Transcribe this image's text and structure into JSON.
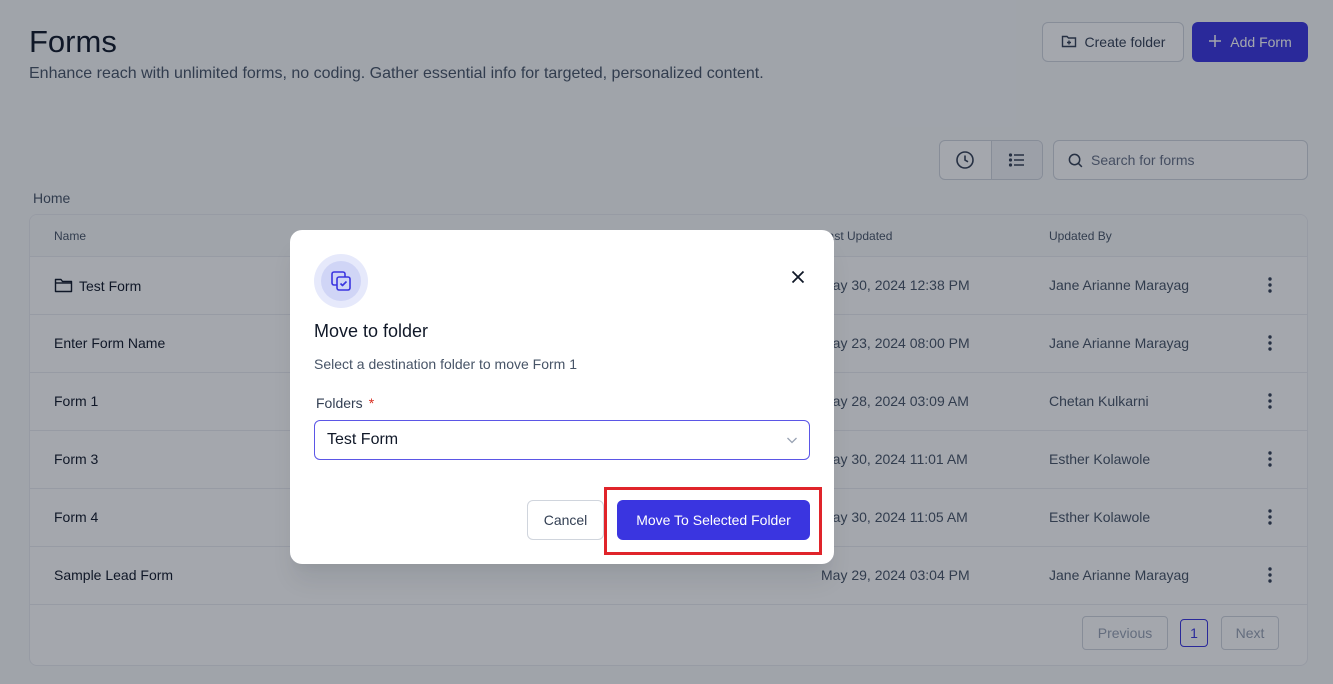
{
  "header": {
    "title": "Forms",
    "subtitle": "Enhance reach with unlimited forms, no coding. Gather essential info for targeted, personalized content.",
    "create_folder_label": "Create folder",
    "add_form_label": "Add Form"
  },
  "toolbar": {
    "search_placeholder": "Search for forms",
    "active_view": "list"
  },
  "breadcrumb": "Home",
  "table": {
    "columns": [
      "Name",
      "Last Updated",
      "Updated By"
    ],
    "rows": [
      {
        "name": "Test Form",
        "type": "folder",
        "updated": "May 30, 2024 12:38 PM",
        "by": "Jane Arianne Marayag"
      },
      {
        "name": "Enter Form Name",
        "type": "form",
        "updated": "May 23, 2024 08:00 PM",
        "by": "Jane Arianne Marayag"
      },
      {
        "name": "Form 1",
        "type": "form",
        "updated": "May 28, 2024 03:09 AM",
        "by": "Chetan Kulkarni"
      },
      {
        "name": "Form 3",
        "type": "form",
        "updated": "May 30, 2024 11:01 AM",
        "by": "Esther Kolawole"
      },
      {
        "name": "Form 4",
        "type": "form",
        "updated": "May 30, 2024 11:05 AM",
        "by": "Esther Kolawole"
      },
      {
        "name": "Sample Lead Form",
        "type": "form",
        "updated": "May 29, 2024 03:04 PM",
        "by": "Jane Arianne Marayag"
      }
    ]
  },
  "pagination": {
    "previous_label": "Previous",
    "current_page": "1",
    "next_label": "Next"
  },
  "modal": {
    "title": "Move to folder",
    "description": "Select a destination folder to move Form 1",
    "field_label": "Folders",
    "required_mark": "*",
    "selected_folder": "Test Form",
    "cancel_label": "Cancel",
    "confirm_label": "Move To Selected Folder"
  },
  "colors": {
    "primary": "#3a35e0",
    "highlight": "#e0242a",
    "overlay": "rgba(16,24,40,0.38)"
  }
}
